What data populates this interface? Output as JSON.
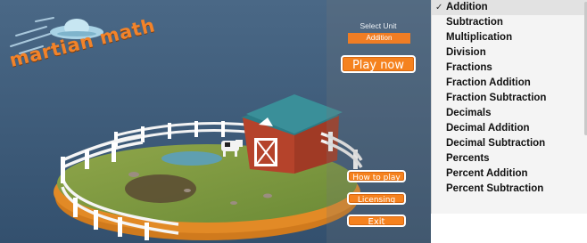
{
  "game": {
    "logo": "martian math",
    "select_unit_label": "Select Unit",
    "selected_unit": "Addition",
    "buttons": {
      "play": "Play now",
      "how_to_play": "How to play",
      "licensing": "Licensing",
      "exit": "Exit"
    }
  },
  "dropdown": {
    "selected": "Addition",
    "options": [
      "Addition",
      "Subtraction",
      "Multiplication",
      "Division",
      "Fractions",
      "Fraction Addition",
      "Fraction Subtraction",
      "Decimals",
      "Decimal Addition",
      "Decimal Subtraction",
      "Percents",
      "Percent Addition",
      "Percent Subtraction"
    ]
  },
  "colors": {
    "sky": "#3b5a79",
    "accent_orange": "#f5821f",
    "grass": "#7d9a3e",
    "barn_red": "#b5432b",
    "barn_roof": "#2f7d86"
  }
}
